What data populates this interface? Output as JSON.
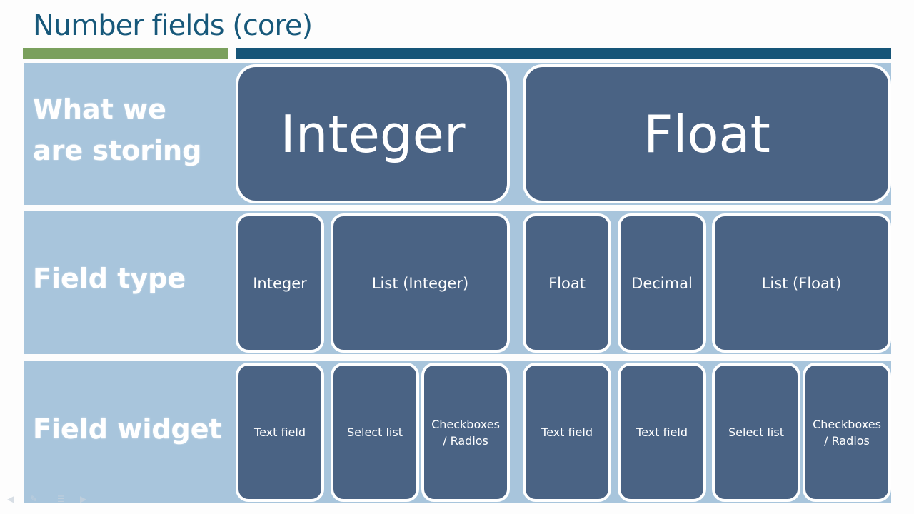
{
  "slide": {
    "title": "Number fields (core)",
    "colors": {
      "title": "#17587a",
      "accent_green": "#7aa05d",
      "accent_blue": "#165578",
      "band": "#a8c5dc",
      "box": "#4a6384",
      "box_border": "#ffffff"
    },
    "rows": [
      {
        "label": "What we are storing",
        "boxes": [
          "Integer",
          "Float"
        ]
      },
      {
        "label": "Field type",
        "boxes": [
          "Integer",
          "List (Integer)",
          "Float",
          "Decimal",
          "List (Float)"
        ]
      },
      {
        "label": "Field widget",
        "boxes": [
          "Text field",
          "Select list",
          "Checkboxes / Radios",
          "Text field",
          "Text field",
          "Select list",
          "Checkboxes / Radios"
        ]
      }
    ],
    "nav_icons": [
      "previous-slide-icon",
      "pen-icon",
      "menu-icon",
      "next-slide-icon"
    ]
  }
}
